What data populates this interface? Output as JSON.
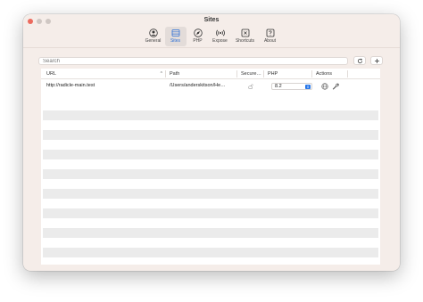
{
  "window": {
    "title": "Sites"
  },
  "tabs": [
    {
      "label": "General",
      "icon": "person-circle-icon"
    },
    {
      "label": "Sites",
      "icon": "folder-stack-icon",
      "active": true
    },
    {
      "label": "PHP",
      "icon": "compass-icon"
    },
    {
      "label": "Expose",
      "icon": "broadcast-icon"
    },
    {
      "label": "Shortcuts",
      "icon": "command-key-icon"
    },
    {
      "label": "About",
      "icon": "question-icon"
    }
  ],
  "search": {
    "placeholder": "Search"
  },
  "toolbar": {
    "refresh_icon": "refresh-icon",
    "add_icon": "plus-icon"
  },
  "table": {
    "columns": {
      "url": "URL",
      "path": "Path",
      "secure": "Secure…",
      "php": "PHP",
      "actions": "Actions"
    },
    "rows": [
      {
        "url": "http://radicle-main.test",
        "path": "/Users/anderskitson/He…",
        "secure_icon": "unlocked-icon",
        "php": "8.2",
        "actions": [
          "globe-icon",
          "wrench-icon"
        ]
      }
    ]
  },
  "colors": {
    "accent": "#2a78e8",
    "window_bg": "#f5ede9",
    "stripe": "#ebebeb"
  }
}
